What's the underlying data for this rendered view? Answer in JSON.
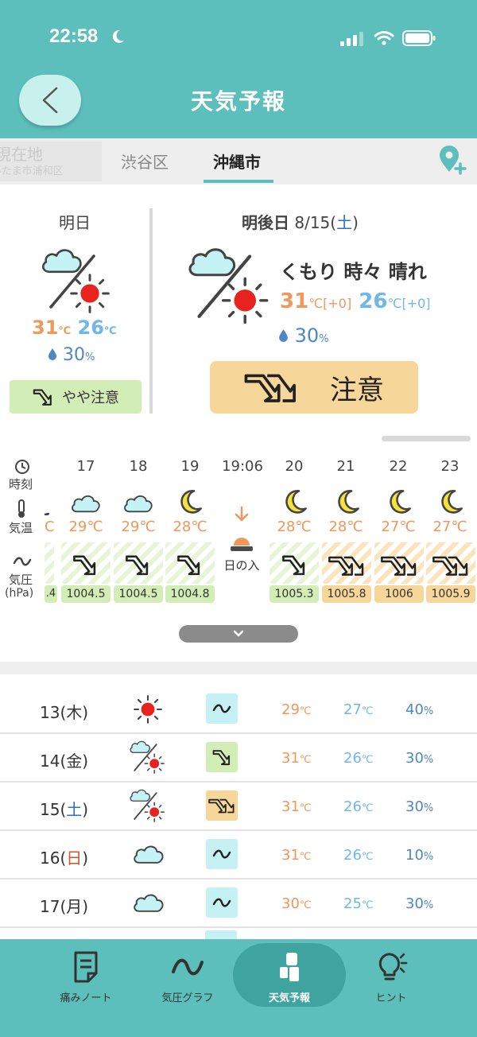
{
  "status": {
    "time": "22:58"
  },
  "header": {
    "title": "天気予報"
  },
  "tabs": {
    "current": "現在地",
    "current_sub": "さいたま市浦和区",
    "shibuya": "渋谷区",
    "okinawa": "沖縄市"
  },
  "tomorrow": {
    "label": "明日",
    "hi": "31",
    "lo": "26",
    "pct": "30",
    "warning": "やや注意"
  },
  "dayafter": {
    "label": "明後日",
    "date": "8/15(",
    "dow": "土",
    "close": ")",
    "desc": "くもり 時々 晴れ",
    "hi": "31",
    "hi_diff": "[+0]",
    "lo": "26",
    "lo_diff": "[+0]",
    "pct": "30",
    "warning": "注意"
  },
  "units": {
    "c": "℃",
    "pct": "%"
  },
  "hourly": {
    "time_label": "時刻",
    "temp_label": "気温",
    "pressure_label": "気圧",
    "pressure_unit": "(hPa)",
    "sunset_label": "日の入",
    "partial_temp": "C",
    "partial_pressure": ".4",
    "hours": [
      {
        "time": "17",
        "temp": "29℃",
        "pressure": "1004.5"
      },
      {
        "time": "18",
        "temp": "29℃",
        "pressure": "1004.5"
      },
      {
        "time": "19",
        "temp": "28℃",
        "pressure": "1004.8"
      },
      {
        "time": "19:06",
        "temp": "",
        "pressure": ""
      },
      {
        "time": "20",
        "temp": "28℃",
        "pressure": "1005.3"
      },
      {
        "time": "21",
        "temp": "28℃",
        "pressure": "1005.8"
      },
      {
        "time": "22",
        "temp": "27℃",
        "pressure": "1006"
      },
      {
        "time": "23",
        "temp": "27℃",
        "pressure": "1005.9"
      }
    ]
  },
  "daily": [
    {
      "day": "13(",
      "dow": "木",
      "close": ")",
      "hi": "29",
      "lo": "27",
      "pct": "40"
    },
    {
      "day": "14(",
      "dow": "金",
      "close": ")",
      "hi": "31",
      "lo": "26",
      "pct": "30"
    },
    {
      "day": "15(",
      "dow": "土",
      "close": ")",
      "hi": "31",
      "lo": "26",
      "pct": "30"
    },
    {
      "day": "16(",
      "dow": "日",
      "close": ")",
      "hi": "31",
      "lo": "26",
      "pct": "10"
    },
    {
      "day": "17(",
      "dow": "月",
      "close": ")",
      "hi": "30",
      "lo": "25",
      "pct": "30"
    }
  ],
  "nav": {
    "notes": "痛みノート",
    "graph": "気圧グラフ",
    "forecast": "天気予報",
    "hint": "ヒント"
  },
  "colors": {
    "accent": "#5cbfbb",
    "hot": "#f0975a",
    "cold": "#6fb6ea",
    "pct": "#4f86c6",
    "caution_green": "#d3edb7",
    "caution_orange": "#f7d69a",
    "saturday": "#2f6fc6",
    "sunday": "#d4552a"
  }
}
